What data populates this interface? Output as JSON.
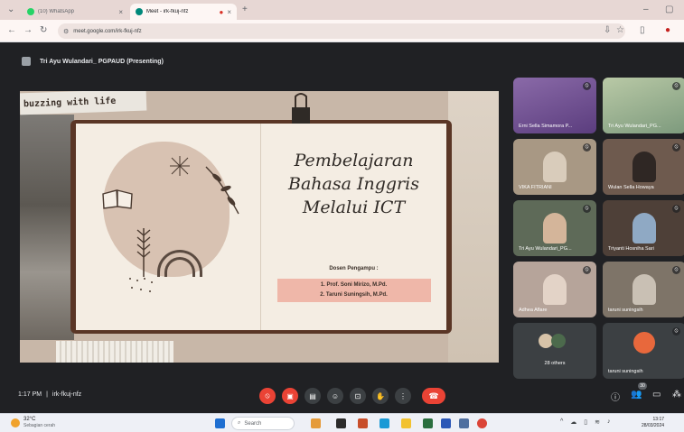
{
  "browser": {
    "tabs": [
      {
        "label": "(10) WhatsApp",
        "active": false
      },
      {
        "label": "Meet - irk-fkuj-nfz",
        "active": true
      }
    ],
    "new_tab_symbol": "+",
    "url": "meet.google.com/irk-fkuj-nfz"
  },
  "meet": {
    "presenter_label": "Tri Ayu Wulandari_ PGPAUD (Presenting)",
    "time": "1:17 PM",
    "separator": "|",
    "meeting_code": "irk-fkuj-nfz",
    "participants_badge": "30"
  },
  "slide": {
    "tagline": "buzzing with life",
    "title_lines": [
      "Pembelajaran",
      "Bahasa Inggris",
      "Melalui ICT"
    ],
    "mentors_heading": "Dosen Pengampu :",
    "mentors": [
      "1. Prof. Soni Mirizo, M.Pd.",
      "2. Taruni Suningsih, M.Pd."
    ]
  },
  "participants": [
    {
      "name": "Erni Sella Simamora P..."
    },
    {
      "name": "Tri Ayu Wulandari_PG..."
    },
    {
      "name": "VIKA FITRIANI"
    },
    {
      "name": "Wulan Sella Howaya"
    },
    {
      "name": "Tri Ayu Wulandari_PG..."
    },
    {
      "name": "Triyanti Hosniha Sari"
    },
    {
      "name": "Adhea Aflare"
    },
    {
      "name": "taruni suningsih"
    },
    {
      "name": "28 others"
    },
    {
      "name": "taruni suningsih"
    }
  ],
  "taskbar": {
    "temp": "32°C",
    "weather": "Sebagian cerah",
    "search_placeholder": "Search",
    "time": "13:17",
    "date": "28/03/2024"
  },
  "colors": {
    "meet_bg": "#202124",
    "red": "#ea4335",
    "tab_strip": "#e7d7d4"
  }
}
